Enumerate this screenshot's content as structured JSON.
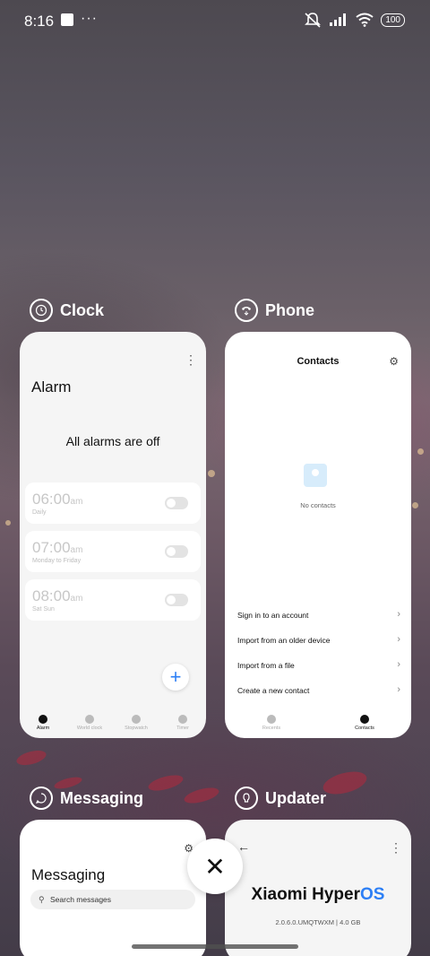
{
  "status_bar": {
    "time": "8:16",
    "more": "···",
    "battery": "100"
  },
  "apps": {
    "clock": {
      "name": "Clock",
      "title": "Alarm",
      "empty_message": "All alarms are off",
      "alarms": [
        {
          "time": "06:00",
          "ampm": "am",
          "days": "Daily",
          "enabled": false
        },
        {
          "time": "07:00",
          "ampm": "am",
          "days": "Monday to Friday",
          "enabled": false
        },
        {
          "time": "08:00",
          "ampm": "am",
          "days": "Sat Sun",
          "enabled": false
        }
      ],
      "add_button": "+",
      "nav": [
        "Alarm",
        "World clock",
        "Stopwatch",
        "Timer"
      ]
    },
    "phone": {
      "name": "Phone",
      "title": "Contacts",
      "empty_message": "No contacts",
      "actions": [
        "Sign in to an account",
        "Import from an older device",
        "Import from a file",
        "Create a new contact"
      ],
      "nav": [
        "Recents",
        "Contacts"
      ]
    },
    "messaging": {
      "name": "Messaging",
      "title": "Messaging",
      "search_placeholder": "Search messages"
    },
    "updater": {
      "name": "Updater",
      "brand_prefix": "Xiaomi Hyper",
      "brand_suffix": "OS",
      "version": "2.0.6.0.UMQTWXM | 4.0 GB"
    }
  },
  "close_label": "✕",
  "colors": {
    "accent": "#2d7ff5"
  }
}
